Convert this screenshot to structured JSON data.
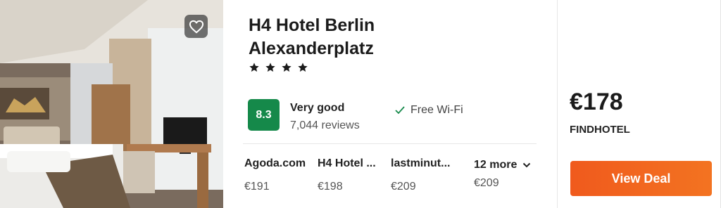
{
  "hotel": {
    "name": "H4 Hotel Berlin Alexanderplatz",
    "stars": 4,
    "favorite_icon": "heart-icon",
    "rating": {
      "score": "8.3",
      "label": "Very good",
      "reviews": "7,044 reviews",
      "color": "#15894a"
    },
    "amenity": {
      "icon": "check-icon",
      "label": "Free Wi-Fi"
    }
  },
  "offers": [
    {
      "provider": "Agoda.com",
      "price": "€191"
    },
    {
      "provider": "H4 Hotel ...",
      "price": "€198"
    },
    {
      "provider": "lastminut...",
      "price": "€209"
    }
  ],
  "more_offers": {
    "label": "12 more",
    "price": "€209",
    "icon": "chevron-down-icon"
  },
  "best_deal": {
    "price": "€178",
    "provider": "FINDHOTEL",
    "button_label": "View Deal",
    "button_color": "#f05a1d"
  }
}
